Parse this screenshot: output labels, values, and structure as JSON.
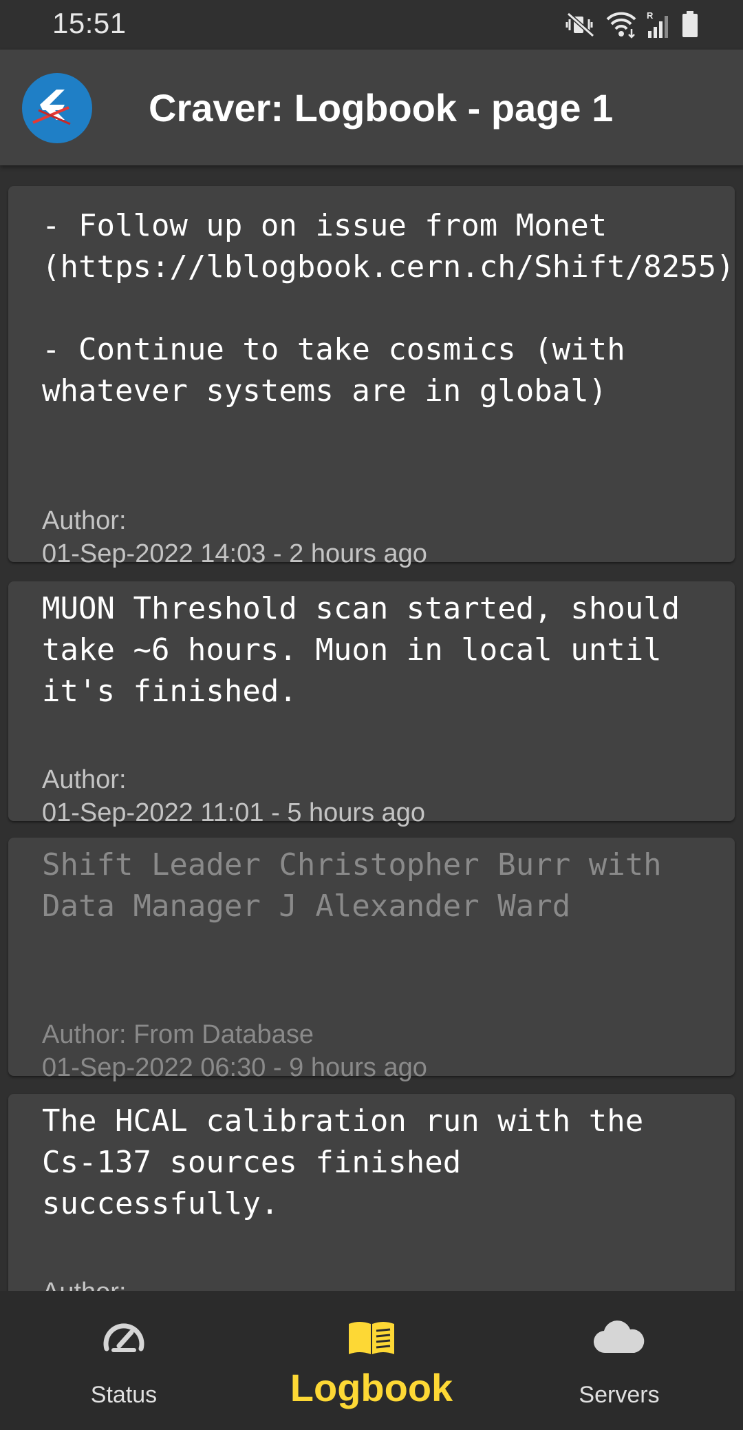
{
  "status_bar": {
    "time": "15:51",
    "icons": [
      "mute-vibrate-icon",
      "wifi-icon",
      "signal-icon",
      "battery-icon"
    ]
  },
  "app_bar": {
    "title": "Craver: Logbook - page 1",
    "logo": "craver-logo-icon"
  },
  "entries": [
    {
      "text": "- Follow up on issue from Monet (https://lblogbook.cern.ch/Shift/8255)\n\n- Continue to take cosmics (with whatever systems are in global)",
      "author": "Author:",
      "time": "01-Sep-2022 14:03 - 2 hours ago",
      "dimmed": false
    },
    {
      "text": "MUON Threshold scan started, should take ~6 hours. Muon in local until it's finished.",
      "author": "Author:",
      "time": "01-Sep-2022 11:01 - 5 hours ago",
      "dimmed": false
    },
    {
      "text": "Shift Leader Christopher Burr with Data Manager J Alexander Ward",
      "author": "Author: From Database",
      "time": "01-Sep-2022 06:30 - 9 hours ago",
      "dimmed": true
    },
    {
      "text": "The HCAL calibration run with the Cs-137 sources finished successfully.",
      "author": "Author:",
      "time": "",
      "dimmed": false
    }
  ],
  "bottom_nav": {
    "items": [
      {
        "label": "Status",
        "icon": "speedometer-icon",
        "active": false
      },
      {
        "label": "Logbook",
        "icon": "book-icon",
        "active": true
      },
      {
        "label": "Servers",
        "icon": "cloud-icon",
        "active": false
      }
    ]
  },
  "colors": {
    "background": "#303030",
    "app_bar": "#424242",
    "card": "#424242",
    "accent": "#fdd835",
    "logo": "#1f7fc6"
  }
}
